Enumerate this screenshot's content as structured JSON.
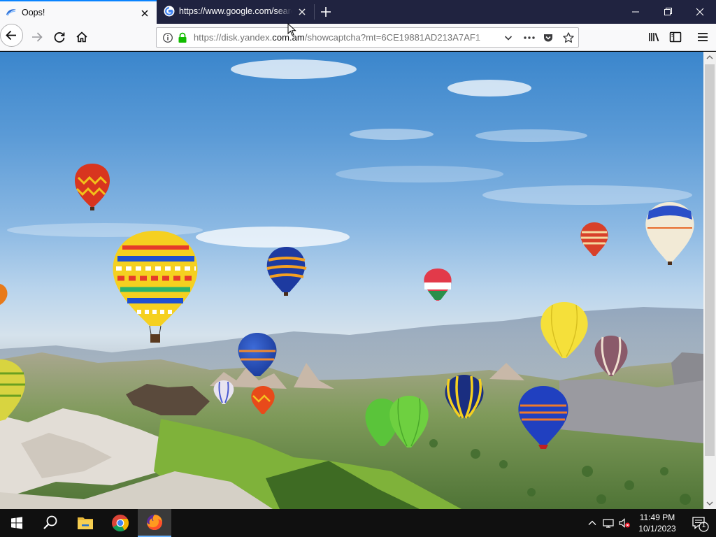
{
  "browser": {
    "tabs": [
      {
        "title": "Oops!",
        "favicon": "yandex-disk-icon",
        "active": true
      },
      {
        "title": "https://www.google.com/search",
        "favicon": "google-icon",
        "active": false
      }
    ],
    "url": {
      "prefix": "https://disk.yandex.",
      "host": "com.am",
      "suffix": "/showcaptcha?mt=6CE19881AD213A7AF1"
    },
    "accent_color": "#0a84ff"
  },
  "content": {
    "image_description": "hot-air-balloons-over-cappadocia"
  },
  "taskbar": {
    "pinned": [
      "start",
      "search",
      "file-explorer",
      "chrome",
      "firefox"
    ],
    "active_app": "firefox",
    "time": "11:49 PM",
    "date": "10/1/2023",
    "notification_count": "1"
  }
}
